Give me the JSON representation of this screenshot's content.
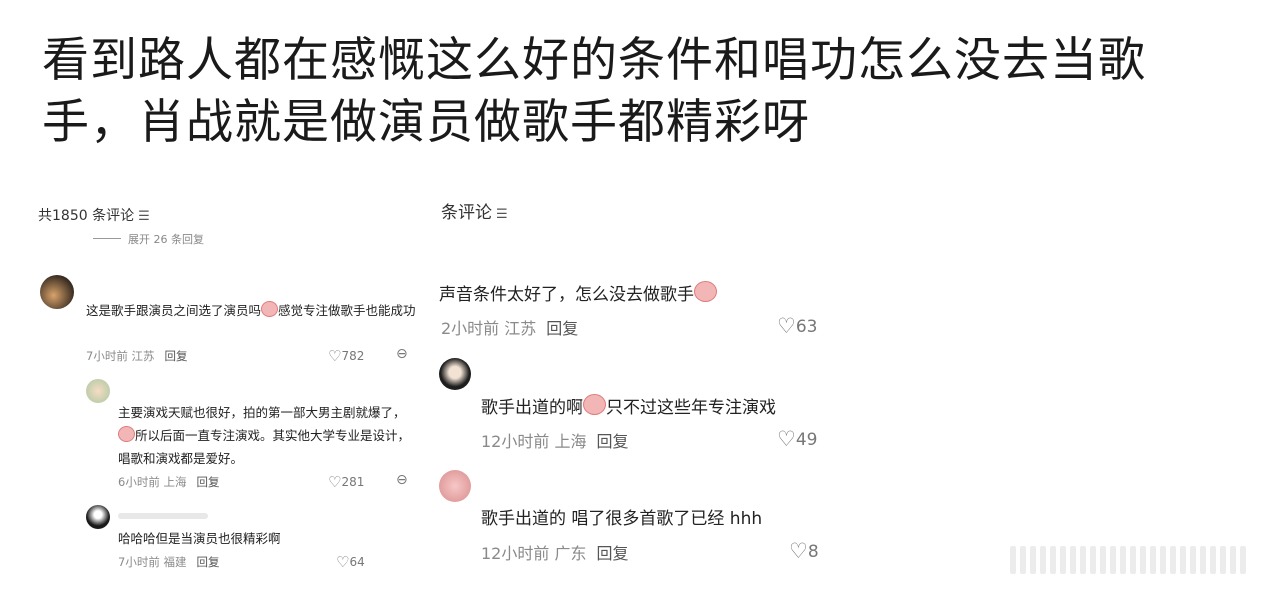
{
  "headline": "看到路人都在感慨这么好的条件和唱功怎么没去当歌手，肖战就是做演员做歌手都精彩呀",
  "left": {
    "header": "共1850 条评论",
    "expand": "展开 26 条回复",
    "comments": [
      {
        "text": "这是歌手跟演员之间选了演员吗",
        "text2": "感觉专注做歌手也能成功",
        "time": "7小时前 江苏",
        "reply": "回复",
        "likes": "782"
      },
      {
        "text": "主要演戏天赋也很好，拍的第一部大男主剧就爆了，",
        "text2": "所以后面一直专注演戏。其实他大学专业是设计，唱歌和演戏都是爱好。",
        "time": "6小时前 上海",
        "reply": "回复",
        "likes": "281"
      },
      {
        "text": "哈哈哈但是当演员也很精彩啊",
        "time": "7小时前 福建",
        "reply": "回复",
        "likes": "64"
      }
    ]
  },
  "right": {
    "header": "条评论",
    "comments": [
      {
        "text": "声音条件太好了，怎么没去做歌手",
        "time": "2小时前 江苏",
        "reply": "回复",
        "likes": "63"
      },
      {
        "text": "歌手出道的啊",
        "text2": "只不过这些年专注演戏",
        "time": "12小时前 上海",
        "reply": "回复",
        "likes": "49"
      },
      {
        "text": "歌手出道的 唱了很多首歌了已经 hhh",
        "time": "12小时前 广东",
        "reply": "回复",
        "likes": "8"
      }
    ]
  },
  "icons": {
    "filter": "filter-icon",
    "heart": "heart-icon",
    "more": "more-icon",
    "emoji": "crying-emoji-icon"
  }
}
